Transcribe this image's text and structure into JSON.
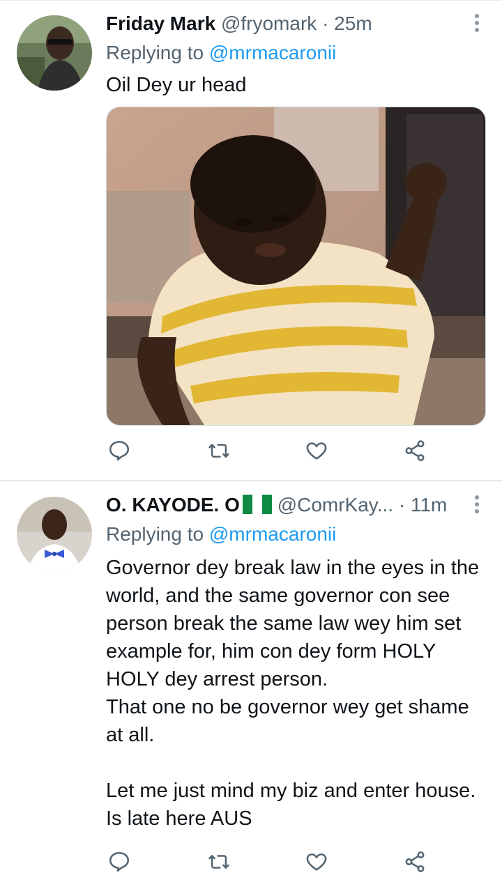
{
  "tweets": [
    {
      "name": "Friday Mark",
      "handle": "@fryomark",
      "separator": "·",
      "time": "25m",
      "reply_prefix": "Replying to",
      "reply_to": "@mrmacaronii",
      "text": "Oil Dey ur head",
      "has_media": true
    },
    {
      "name": "O. KAYODE. O",
      "handle": "@ComrKay...",
      "separator": "·",
      "time": "11m",
      "reply_prefix": "Replying to",
      "reply_to": "@mrmacaronii",
      "text": "Governor dey break law in the eyes in the world, and the same governor con see person break the same law wey him set example for, him con dey form HOLY HOLY dey arrest person.\nThat one no be governor wey get shame at all.\n\nLet me just mind my biz and enter house. Is late here AUS",
      "has_media": false
    }
  ],
  "icons": {
    "reply": "reply-icon",
    "retweet": "retweet-icon",
    "like": "heart-icon",
    "share": "share-icon",
    "more": "more-vertical-icon"
  },
  "colors": {
    "text": "#0f1419",
    "secondary": "#536471",
    "link": "#1d9bf0"
  }
}
